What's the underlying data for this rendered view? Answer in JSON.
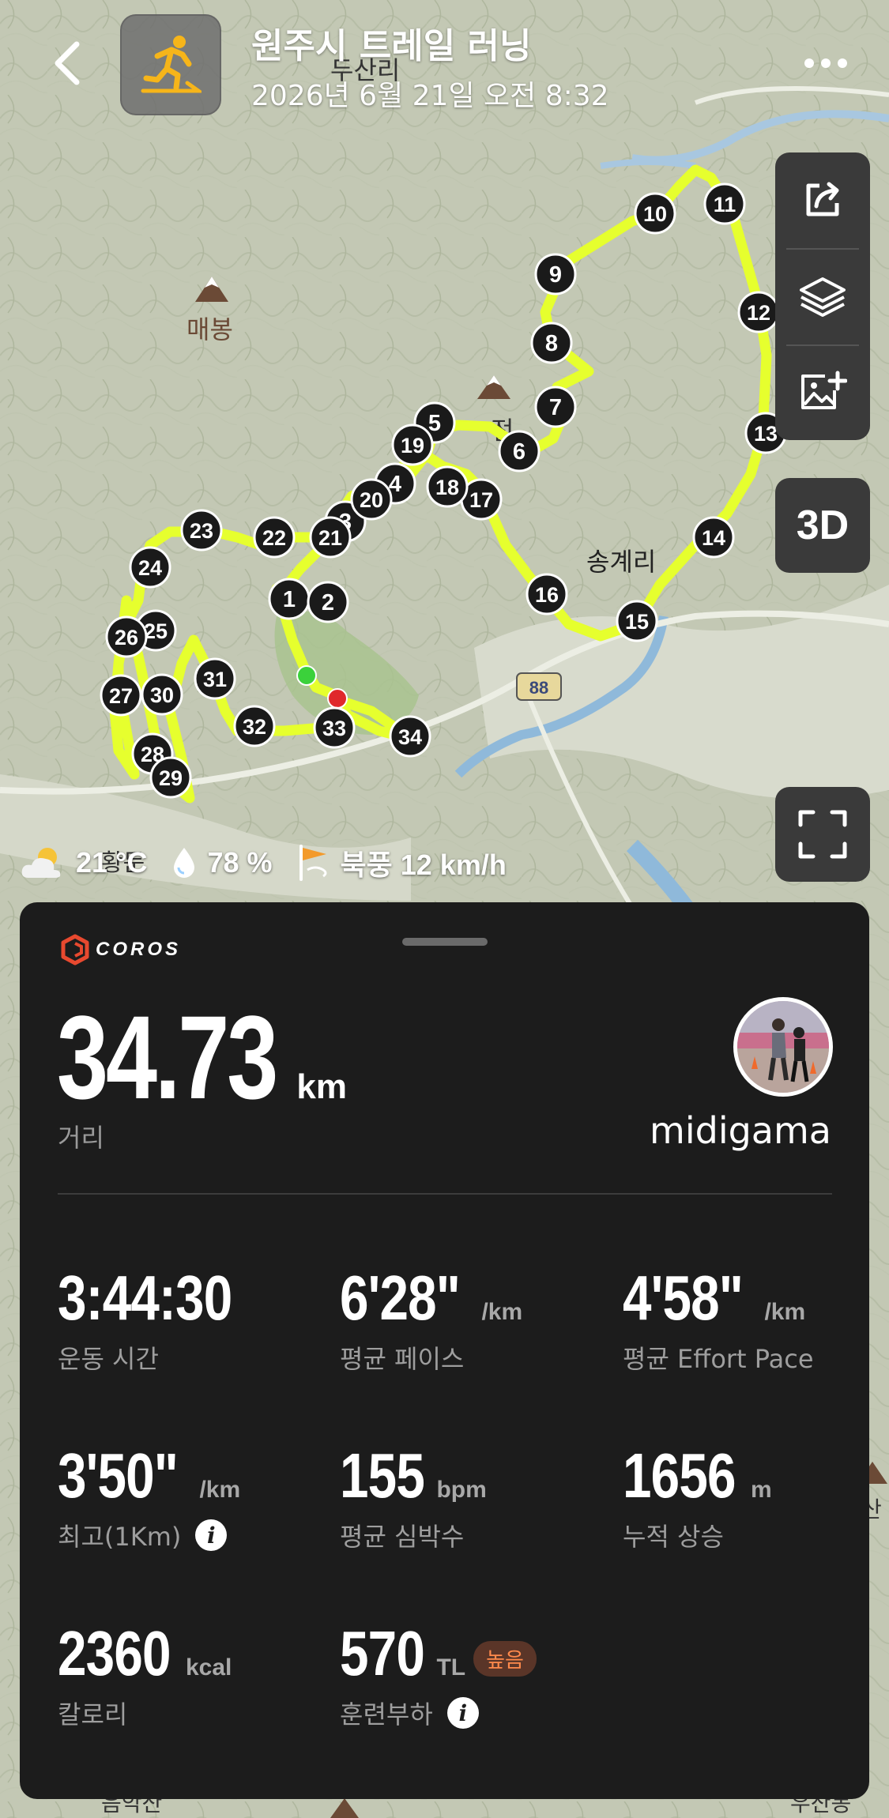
{
  "header": {
    "back_icon": "chevron-left-icon",
    "activity_icon": "trail-running-icon",
    "title": "원주시 트레일 러닝",
    "datetime": "2026년 6월 21일 오전 8:32",
    "more_icon": "ellipsis-icon"
  },
  "map": {
    "place_labels": {
      "dusanri": "두산리",
      "maebong": "매봉",
      "songgyeri": "송계리",
      "jeon": "전",
      "hwangdun": "황둔",
      "road": "88",
      "bottom_left": "음악산",
      "bottom_right": "우산동",
      "right_edge": "산"
    },
    "route_color": "#e6ff2e",
    "marker_color": "#1a1a1a",
    "start_color": "#3bd13b",
    "end_color": "#e0282c",
    "km_markers": [
      "1",
      "2",
      "3",
      "4",
      "5",
      "6",
      "7",
      "8",
      "9",
      "10",
      "11",
      "12",
      "13",
      "14",
      "15",
      "16",
      "17",
      "18",
      "19",
      "20",
      "21",
      "22",
      "23",
      "24",
      "25",
      "26",
      "27",
      "28",
      "29",
      "30",
      "31",
      "32",
      "33",
      "34"
    ]
  },
  "tools": {
    "share_icon": "share-icon",
    "layers_icon": "layers-icon",
    "add_photo_icon": "add-photo-icon",
    "btn_3d": "3D",
    "fullscreen_icon": "fullscreen-icon"
  },
  "weather": {
    "temperature": "21 °C",
    "humidity": "78 %",
    "wind": "북풍 12 km/h",
    "icons": [
      "partly-cloudy-icon",
      "humidity-drop-icon",
      "wind-flag-icon"
    ]
  },
  "card": {
    "brand": "COROS",
    "distance_value": "34.73",
    "distance_unit": "km",
    "distance_label": "거리",
    "username": "midigama",
    "accent": "#e8492f",
    "stats": [
      {
        "value": "3:44:30",
        "unit": "",
        "label": "운동 시간"
      },
      {
        "value": "6'28\"",
        "unit": "/km",
        "label": "평균 페이스"
      },
      {
        "value": "4'58\"",
        "unit": "/km",
        "label": "평균 Effort Pace"
      },
      {
        "value": "3'50\"",
        "unit": "/km",
        "label": "최고(1Km)"
      },
      {
        "value": "155",
        "unit": "bpm",
        "label": "평균 심박수"
      },
      {
        "value": "1656",
        "unit": "m",
        "label": "누적 상승"
      },
      {
        "value": "2360",
        "unit": "kcal",
        "label": "칼로리"
      },
      {
        "value": "570",
        "unit": "TL",
        "label": "훈련부하",
        "badge": "높음"
      }
    ]
  }
}
